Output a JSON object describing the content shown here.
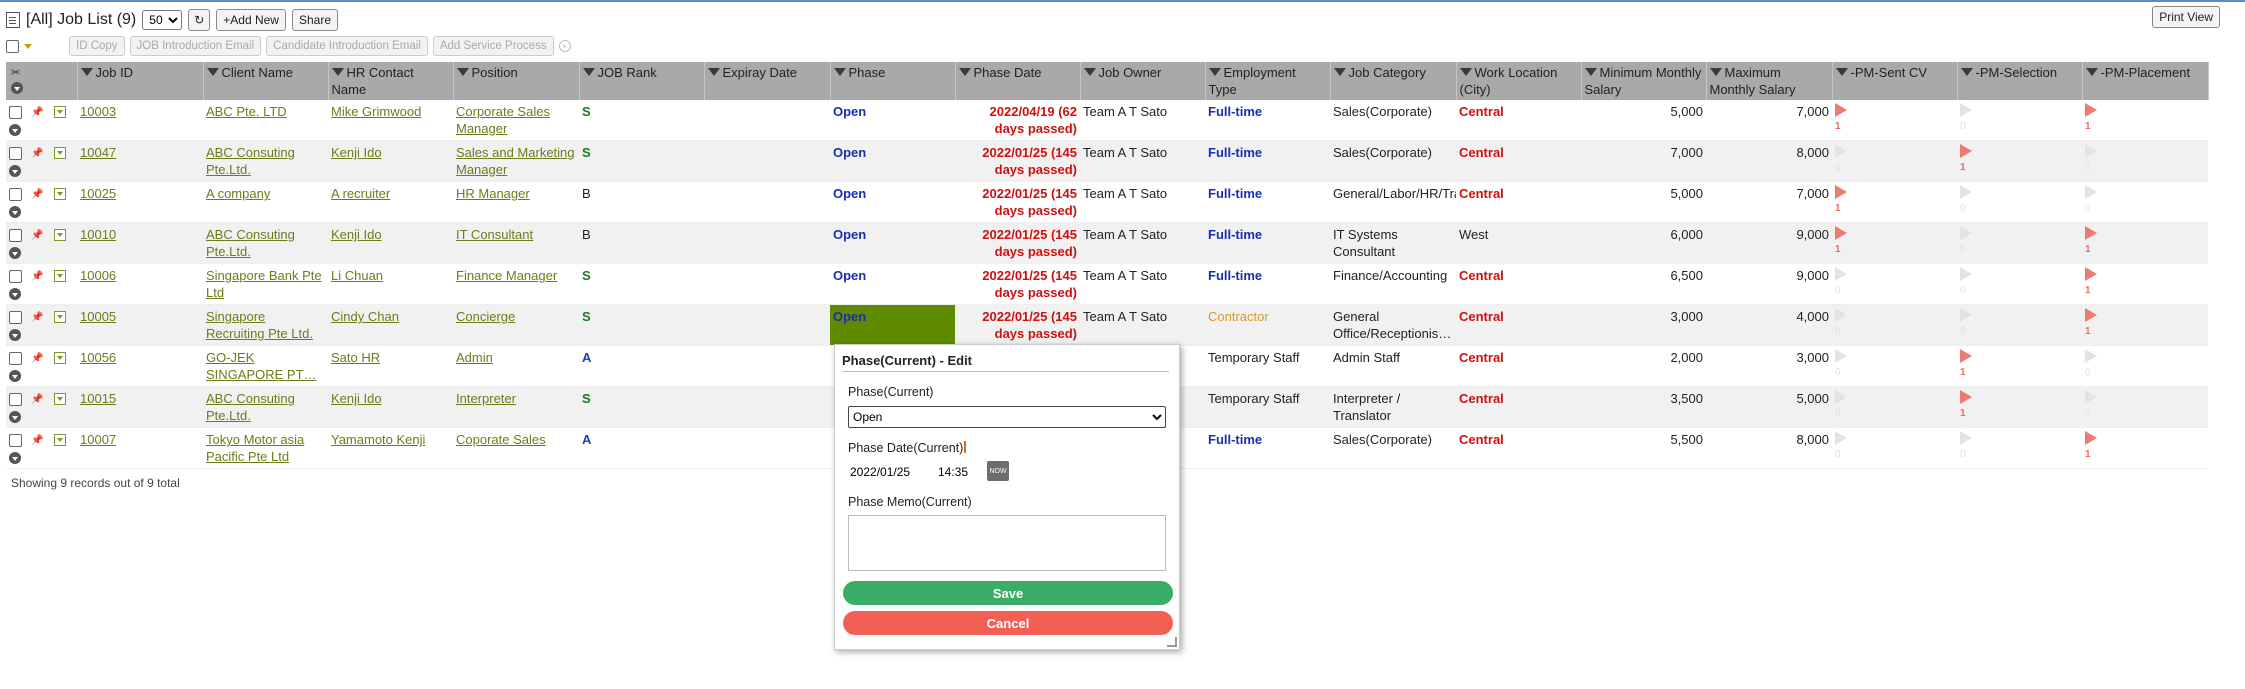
{
  "header": {
    "title": "[All] Job List (9)",
    "per_page": "50",
    "add_new": "+Add New",
    "share": "Share",
    "print_view": "Print View"
  },
  "toolbar": {
    "buttons": [
      "ID Copy",
      "JOB Introduction Email",
      "Candidate Introduction Email",
      "Add Service Process"
    ]
  },
  "columns": [
    "Job ID",
    "Client Name",
    "HR Contact Name",
    "Position",
    "JOB Rank",
    "Expiray Date",
    "Phase",
    "Phase Date",
    "Job Owner",
    "Employment Type",
    "Job Category",
    "Work Location (City)",
    "Minimum Monthly Salary",
    "Maximum Monthly Salary",
    "-PM-Sent CV",
    "-PM-Selection",
    "-PM-Placement"
  ],
  "rows": [
    {
      "id": "10003",
      "client": "ABC Pte. LTD",
      "hr": "Mike Grimwood",
      "position": "Corporate Sales Manager",
      "rank": "S",
      "expiry": "",
      "phase": "Open",
      "phase_date": "2022/04/19 (62 days passed)",
      "owner": "Team A T Sato",
      "emp": "Full-time",
      "category": "Sales(Corporate)",
      "city": "Central",
      "min": "5,000",
      "max": "7,000",
      "cv": "1",
      "sel": "0",
      "plc": "1"
    },
    {
      "id": "10047",
      "client": "ABC Consuting Pte.Ltd.",
      "hr": "Kenji Ido",
      "position": "Sales and Marketing Manager",
      "rank": "S",
      "expiry": "",
      "phase": "Open",
      "phase_date": "2022/01/25 (145 days passed)",
      "owner": "Team A T Sato",
      "emp": "Full-time",
      "category": "Sales(Corporate)",
      "city": "Central",
      "min": "7,000",
      "max": "8,000",
      "cv": "0",
      "sel": "1",
      "plc": "0"
    },
    {
      "id": "10025",
      "client": "A company",
      "hr": "A recruiter",
      "position": "HR Manager",
      "rank": "B",
      "expiry": "",
      "phase": "Open",
      "phase_date": "2022/01/25 (145 days passed)",
      "owner": "Team A T Sato",
      "emp": "Full-time",
      "category": "General/Labor/HR/Training",
      "city": "Central",
      "min": "5,000",
      "max": "7,000",
      "cv": "1",
      "sel": "0",
      "plc": "0"
    },
    {
      "id": "10010",
      "client": "ABC Consuting Pte.Ltd.",
      "hr": "Kenji Ido",
      "position": "IT Consultant",
      "rank": "B",
      "expiry": "",
      "phase": "Open",
      "phase_date": "2022/01/25 (145 days passed)",
      "owner": "Team A T Sato",
      "emp": "Full-time",
      "category": "IT Systems Consultant",
      "city": "West",
      "min": "6,000",
      "max": "9,000",
      "cv": "1",
      "sel": "0",
      "plc": "1"
    },
    {
      "id": "10006",
      "client": "Singapore Bank Pte Ltd",
      "hr": "Li Chuan",
      "position": "Finance Manager",
      "rank": "S",
      "expiry": "",
      "phase": "Open",
      "phase_date": "2022/01/25 (145 days passed)",
      "owner": "Team A T Sato",
      "emp": "Full-time",
      "category": "Finance/Accounting",
      "city": "Central",
      "min": "6,500",
      "max": "9,000",
      "cv": "0",
      "sel": "0",
      "plc": "1"
    },
    {
      "id": "10005",
      "client": "Singapore Recruiting Pte Ltd.",
      "hr": "Cindy Chan",
      "position": "Concierge",
      "rank": "S",
      "expiry": "",
      "phase": "Open",
      "phase_date": "2022/01/25 (145 days passed)",
      "owner": "Team A T Sato",
      "emp": "Contractor",
      "category": "General Office/Receptionis…",
      "city": "Central",
      "min": "3,000",
      "max": "4,000",
      "cv": "0",
      "sel": "0",
      "plc": "1"
    },
    {
      "id": "10056",
      "client": "GO-JEK SINGAPORE PT…",
      "hr": "Sato HR",
      "position": "Admin",
      "rank": "A",
      "expiry": "",
      "phase": "",
      "phase_date": "",
      "owner": "",
      "emp": "Temporary Staff",
      "category": "Admin Staff",
      "city": "Central",
      "min": "2,000",
      "max": "3,000",
      "cv": "0",
      "sel": "1",
      "plc": "0"
    },
    {
      "id": "10015",
      "client": "ABC Consuting Pte.Ltd.",
      "hr": "Kenji Ido",
      "position": "Interpreter",
      "rank": "S",
      "expiry": "",
      "phase": "",
      "phase_date": "",
      "owner": "",
      "emp": "Temporary Staff",
      "category": "Interpreter / Translator",
      "city": "Central",
      "min": "3,500",
      "max": "5,000",
      "cv": "0",
      "sel": "1",
      "plc": "0"
    },
    {
      "id": "10007",
      "client": "Tokyo Motor asia Pacific Pte Ltd",
      "hr": "Yamamoto Kenji",
      "position": "Coporate Sales",
      "rank": "A",
      "expiry": "",
      "phase": "",
      "phase_date": "",
      "owner": "",
      "emp": "Full-time",
      "category": "Sales(Corporate)",
      "city": "Central",
      "min": "5,500",
      "max": "8,000",
      "cv": "0",
      "sel": "0",
      "plc": "1"
    }
  ],
  "footer": {
    "text": "Showing 9 records out of 9 total"
  },
  "popup": {
    "title": "Phase(Current) - Edit",
    "phase_label": "Phase(Current)",
    "phase_value": "Open",
    "date_label": "Phase Date(Current)",
    "date_value": "2022/01/25",
    "time_value": "14:35",
    "now_label": "NOW",
    "memo_label": "Phase Memo(Current)",
    "save": "Save",
    "cancel": "Cancel"
  },
  "colors": {
    "header_bg": "#a9a9a9",
    "link": "#6b7d1a",
    "save": "#3aae67",
    "cancel": "#f26055",
    "phase_highlight": "#5f8b00",
    "flag": "#ee7b72"
  }
}
